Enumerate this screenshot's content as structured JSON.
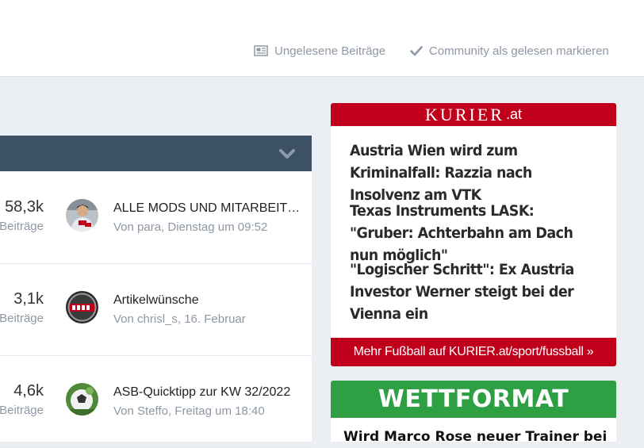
{
  "header": {
    "unread_label": "Ungelesene Beiträge",
    "mark_read_label": "Community als gelesen markieren"
  },
  "forum": {
    "rows": [
      {
        "count": "58,3k",
        "count_label": "Beiträge",
        "last_title": "ALLE MODS UND MITARBEITER",
        "last_meta": "Von para, Dienstag um 09:52"
      },
      {
        "count": "3,1k",
        "count_label": "Beiträge",
        "last_title": "Artikelwünsche",
        "last_meta": "Von chrisl_s, 16. Februar"
      },
      {
        "count": "4,6k",
        "count_label": "Beiträge",
        "last_title": "ASB-Quicktipp zur KW 32/2022",
        "last_meta": "Von Steffo, Freitag um 18:40"
      }
    ]
  },
  "kurier": {
    "brand": "KURIER",
    "tld": ".at",
    "accent": "#c0001b",
    "articles": [
      "Austria Wien wird zum Kriminalfall: Razzia nach Insolvenz am VTK",
      "Texas Instruments LASK: \"Gruber: Achterbahn am Dach nun möglich\"",
      "\"Logischer Schritt\": Ex Austria Investor Werner steigt bei der Vienna ein"
    ],
    "more_label": "Mehr Fußball auf KURIER.at/sport/fussball »"
  },
  "wettformat": {
    "brand": "WETTFORMAT",
    "accent": "#2ea043",
    "article": "Wird Marco Rose neuer Trainer bei"
  }
}
